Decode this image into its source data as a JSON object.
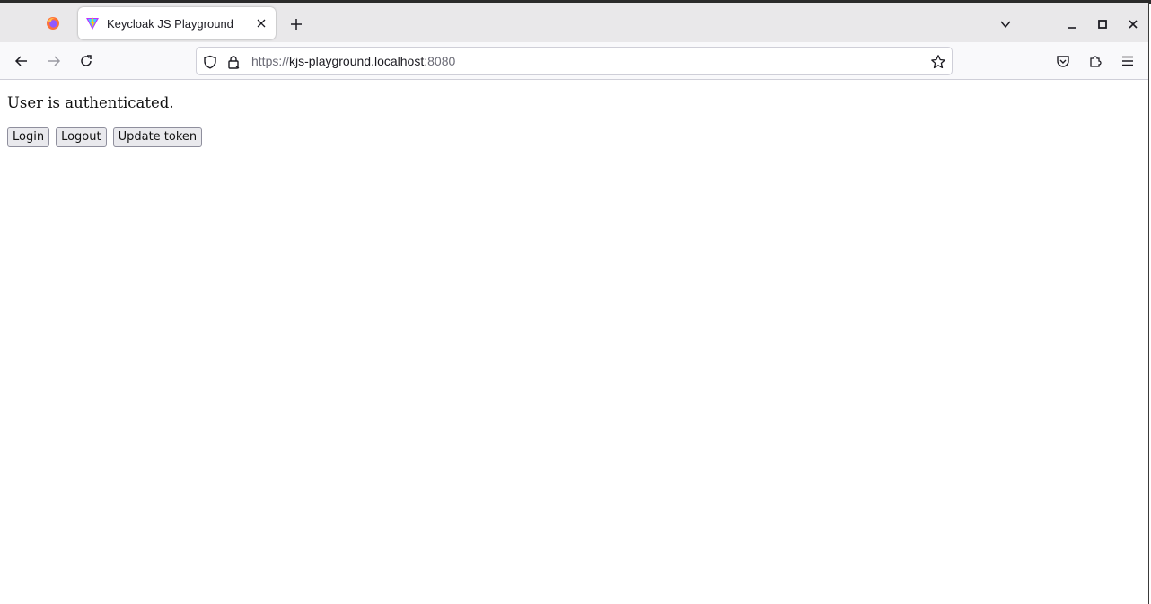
{
  "browser": {
    "tab": {
      "title": "Keycloak JS Playground"
    },
    "url": {
      "scheme": "https://",
      "host": "kjs-playground.localhost",
      "port": ":8080"
    },
    "icons": [
      "firefox-icon",
      "keycloak-favicon-icon",
      "close-icon",
      "plus-icon",
      "chevron-down-icon",
      "minimize-icon",
      "maximize-icon",
      "window-close-icon",
      "back-arrow-icon",
      "forward-arrow-icon",
      "reload-icon",
      "shield-icon",
      "lock-icon",
      "star-icon",
      "pocket-icon",
      "extensions-icon",
      "menu-icon"
    ]
  },
  "page": {
    "status": "User is authenticated.",
    "buttons": {
      "login": "Login",
      "logout": "Logout",
      "update_token": "Update token"
    }
  }
}
